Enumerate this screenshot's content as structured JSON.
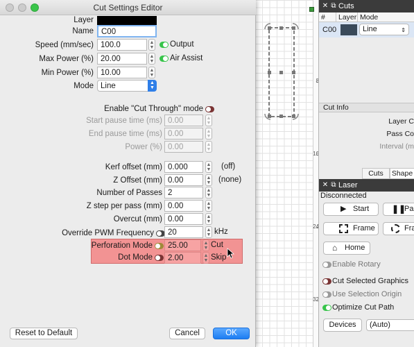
{
  "dialog": {
    "title": "Cut Settings Editor",
    "layer_label": "Layer",
    "name_label": "Name",
    "name_value": "C00",
    "speed": {
      "label": "Speed (mm/sec)",
      "value": "100.0",
      "toggle_label": "Output"
    },
    "max_power": {
      "label": "Max Power (%)",
      "value": "20.00",
      "toggle_label": "Air Assist"
    },
    "min_power": {
      "label": "Min Power (%)",
      "value": "10.00"
    },
    "mode": {
      "label": "Mode",
      "value": "Line"
    },
    "cut_through": {
      "label": "Enable \"Cut Through\" mode"
    },
    "start_pause": {
      "label": "Start pause time (ms)",
      "value": "0.00"
    },
    "end_pause": {
      "label": "End pause time (ms)",
      "value": "0.00"
    },
    "power": {
      "label": "Power (%)",
      "value": "0.00"
    },
    "kerf": {
      "label": "Kerf offset (mm)",
      "value": "0.000",
      "suffix": "(off)"
    },
    "z_offset": {
      "label": "Z Offset (mm)",
      "value": "0.00",
      "suffix": "(none)"
    },
    "passes": {
      "label": "Number of Passes",
      "value": "2"
    },
    "z_step": {
      "label": "Z step per pass (mm)",
      "value": "0.00"
    },
    "overcut": {
      "label": "Overcut (mm)",
      "value": "0.00"
    },
    "pwm": {
      "label": "Override PWM Frequency",
      "value": "20",
      "suffix": "kHz"
    },
    "perforation": {
      "label": "Perforation Mode",
      "value": "25.00",
      "suffix": "Cut"
    },
    "dot_mode": {
      "label": "Dot Mode",
      "value": "2.00",
      "suffix": "Skip"
    },
    "reset_button": "Reset to Default",
    "cancel_button": "Cancel",
    "ok_button": "OK"
  },
  "ruler": {
    "ticks": [
      "8",
      "16",
      "24",
      "32"
    ]
  },
  "cuts_panel": {
    "title": "Cuts",
    "headers": [
      "#",
      "Layer",
      "Mode"
    ],
    "row": {
      "id": "C00",
      "mode": "Line",
      "layer_color": "#3a4a5a"
    },
    "cut_info_label": "Cut Info",
    "info_rows": [
      "Layer C",
      "Pass Co",
      "Interval (m"
    ],
    "tabs": [
      "Cuts",
      "Shape"
    ]
  },
  "laser_panel": {
    "title": "Laser",
    "status": "Disconnected",
    "start_button": "Start",
    "pause_button": "Pau",
    "frame_button": "Frame",
    "frame2_button": "Fra",
    "home_button": "Home",
    "enable_rotary": "Enable Rotary",
    "cut_selected": "Cut Selected Graphics",
    "use_selection_origin": "Use Selection Origin",
    "optimize_cut_path": "Optimize Cut Path",
    "devices_button": "Devices",
    "devices_value": "(Auto)"
  },
  "colors": {
    "highlight": "#f29393",
    "accent": "#1d7df2",
    "panel_title": "#3b3b3b"
  }
}
